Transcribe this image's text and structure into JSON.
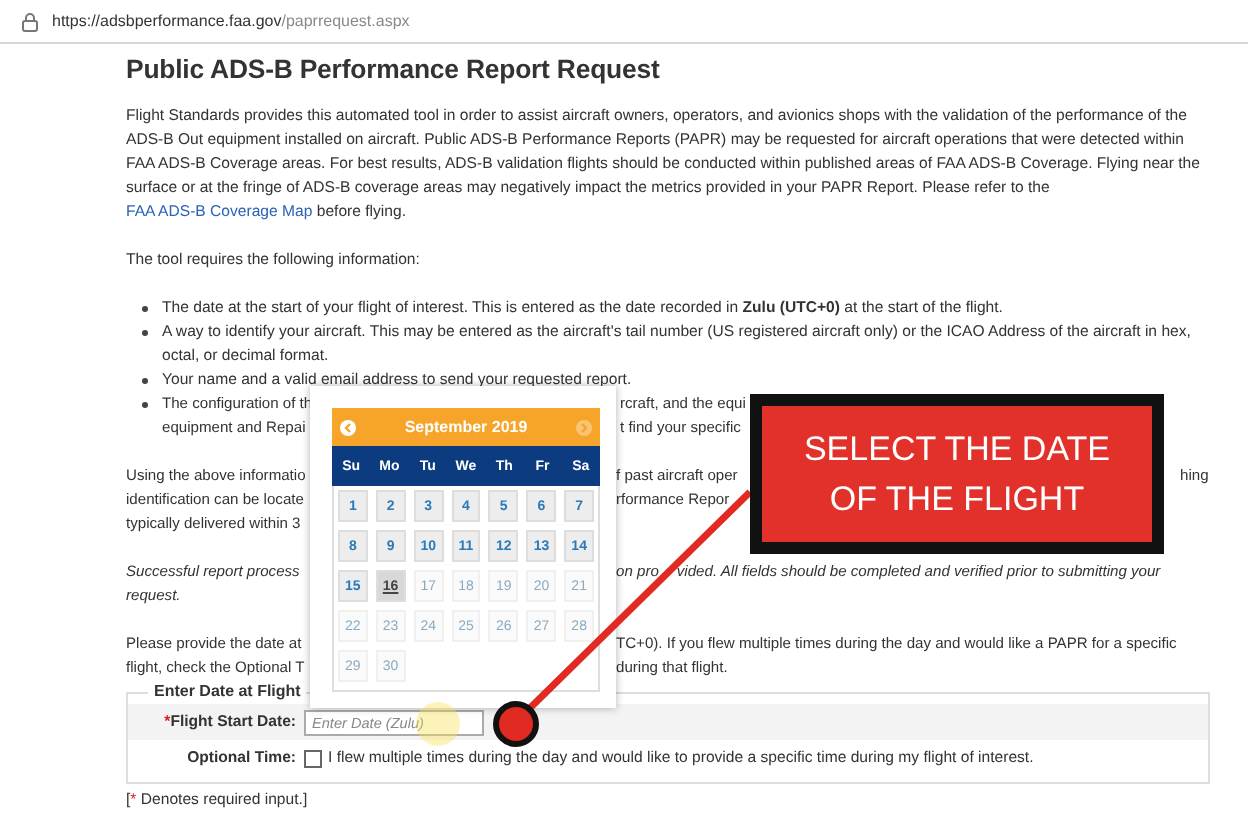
{
  "address_bar": {
    "host": "https://adsbperformance.faa.gov",
    "path": "/paprrequest.aspx"
  },
  "title": "Public ADS-B Performance Report Request",
  "intro": {
    "text": "Flight Standards provides this automated tool in order to assist aircraft owners, operators, and avionics shops with the validation of the performance of the ADS-B Out equipment installed on aircraft. Public ADS-B Performance Reports (PAPR) may be requested for aircraft operations that were detected within FAA ADS-B Coverage areas. For best results, ADS-B validation flights should be conducted within published areas of FAA ADS-B Coverage. Flying near the surface or at the fringe of ADS-B coverage areas may negatively impact the metrics provided in your PAPR Report. Please refer to the",
    "link": "FAA ADS-B Coverage Map",
    "text_after": "before flying."
  },
  "requirements_intro": "The tool requires the following information:",
  "requirements": [
    {
      "kind": "full",
      "text": "The date at the start of your flight of interest. This is entered as the date recorded in **Zulu (UTC+0)** at the start of the flight."
    },
    {
      "kind": "full",
      "text": "A way to identify your aircraft. This may be entered as the aircraft's tail number (US registered aircraft only) or the ICAO Address of the aircraft in hex, octal, or decimal format."
    },
    {
      "kind": "full",
      "text": "Your name and a valid email address to send your requested report."
    },
    {
      "kind": "partial",
      "lines": [
        {
          "kind": "columns",
          "segments": [
            "The configuration of th",
            "rcraft, and the equi"
          ]
        },
        {
          "kind": "columns",
          "segments": [
            "equipment and Repai",
            "t find your specific"
          ]
        }
      ]
    }
  ],
  "paragraphs": [
    {
      "italic": false,
      "lines": [
        {
          "kind": "columns",
          "segments": [
            "Using the above informatio",
            "f past aircraft oper",
            "hing"
          ]
        },
        {
          "kind": "columns",
          "segments": [
            "identification can be locate",
            "rformance Repor"
          ]
        },
        {
          "kind": "columns",
          "segments": [
            "typically delivered within 3"
          ]
        }
      ]
    },
    {
      "italic": true,
      "lines": [
        {
          "kind": "crossed",
          "segments": [
            "Successful report process",
            "on pro",
            "vided. All fields should be completed and verified prior to submitting your"
          ]
        },
        {
          "kind": "columns",
          "segments": [
            "request."
          ]
        }
      ]
    },
    {
      "italic": false,
      "lines": [
        {
          "kind": "columns",
          "segments": [
            "Please provide the date at",
            "TC+0). If you flew multiple times during the day and would like a PAPR for a specific"
          ]
        },
        {
          "kind": "columns",
          "segments": [
            "flight, check the Optional T",
            "during that flight."
          ]
        }
      ]
    }
  ],
  "form": {
    "legend": "Enter Date at Flight",
    "date_field": {
      "required_mark": "*",
      "label": "Flight Start Date:",
      "placeholder": "Enter Date (Zulu)"
    },
    "time_field": {
      "label": "Optional Time:",
      "checked": false,
      "checkbox_label": "I flew multiple times during the day and would like to provide a specific time during my flight of interest."
    },
    "note": {
      "open": "[",
      "mark": "*",
      "text": " Denotes required input.]"
    }
  },
  "calendar": {
    "month_title": "September 2019",
    "prev_disabled": false,
    "next_disabled": true,
    "weekdays": [
      "Su",
      "Mo",
      "Tu",
      "We",
      "Th",
      "Fr",
      "Sa"
    ],
    "days": [
      {
        "label": "1",
        "disabled": false,
        "highlighted": false
      },
      {
        "label": "2",
        "disabled": false,
        "highlighted": false
      },
      {
        "label": "3",
        "disabled": false,
        "highlighted": false
      },
      {
        "label": "4",
        "disabled": false,
        "highlighted": false
      },
      {
        "label": "5",
        "disabled": false,
        "highlighted": false
      },
      {
        "label": "6",
        "disabled": false,
        "highlighted": false
      },
      {
        "label": "7",
        "disabled": false,
        "highlighted": false
      },
      {
        "label": "8",
        "disabled": false,
        "highlighted": false
      },
      {
        "label": "9",
        "disabled": false,
        "highlighted": false
      },
      {
        "label": "10",
        "disabled": false,
        "highlighted": false
      },
      {
        "label": "11",
        "disabled": false,
        "highlighted": false
      },
      {
        "label": "12",
        "disabled": false,
        "highlighted": false
      },
      {
        "label": "13",
        "disabled": false,
        "highlighted": false
      },
      {
        "label": "14",
        "disabled": false,
        "highlighted": false
      },
      {
        "label": "15",
        "disabled": false,
        "highlighted": false
      },
      {
        "label": "16",
        "disabled": false,
        "highlighted": true
      },
      {
        "label": "17",
        "disabled": true,
        "highlighted": false
      },
      {
        "label": "18",
        "disabled": true,
        "highlighted": false
      },
      {
        "label": "19",
        "disabled": true,
        "highlighted": false
      },
      {
        "label": "20",
        "disabled": true,
        "highlighted": false
      },
      {
        "label": "21",
        "disabled": true,
        "highlighted": false
      },
      {
        "label": "22",
        "disabled": true,
        "highlighted": false
      },
      {
        "label": "23",
        "disabled": true,
        "highlighted": false
      },
      {
        "label": "24",
        "disabled": true,
        "highlighted": false
      },
      {
        "label": "25",
        "disabled": true,
        "highlighted": false
      },
      {
        "label": "26",
        "disabled": true,
        "highlighted": false
      },
      {
        "label": "27",
        "disabled": true,
        "highlighted": false
      },
      {
        "label": "28",
        "disabled": true,
        "highlighted": false
      },
      {
        "label": "29",
        "disabled": true,
        "highlighted": false
      },
      {
        "label": "30",
        "disabled": true,
        "highlighted": false
      }
    ]
  },
  "callout": {
    "text": "SELECT THE DATE OF THE FLIGHT"
  }
}
